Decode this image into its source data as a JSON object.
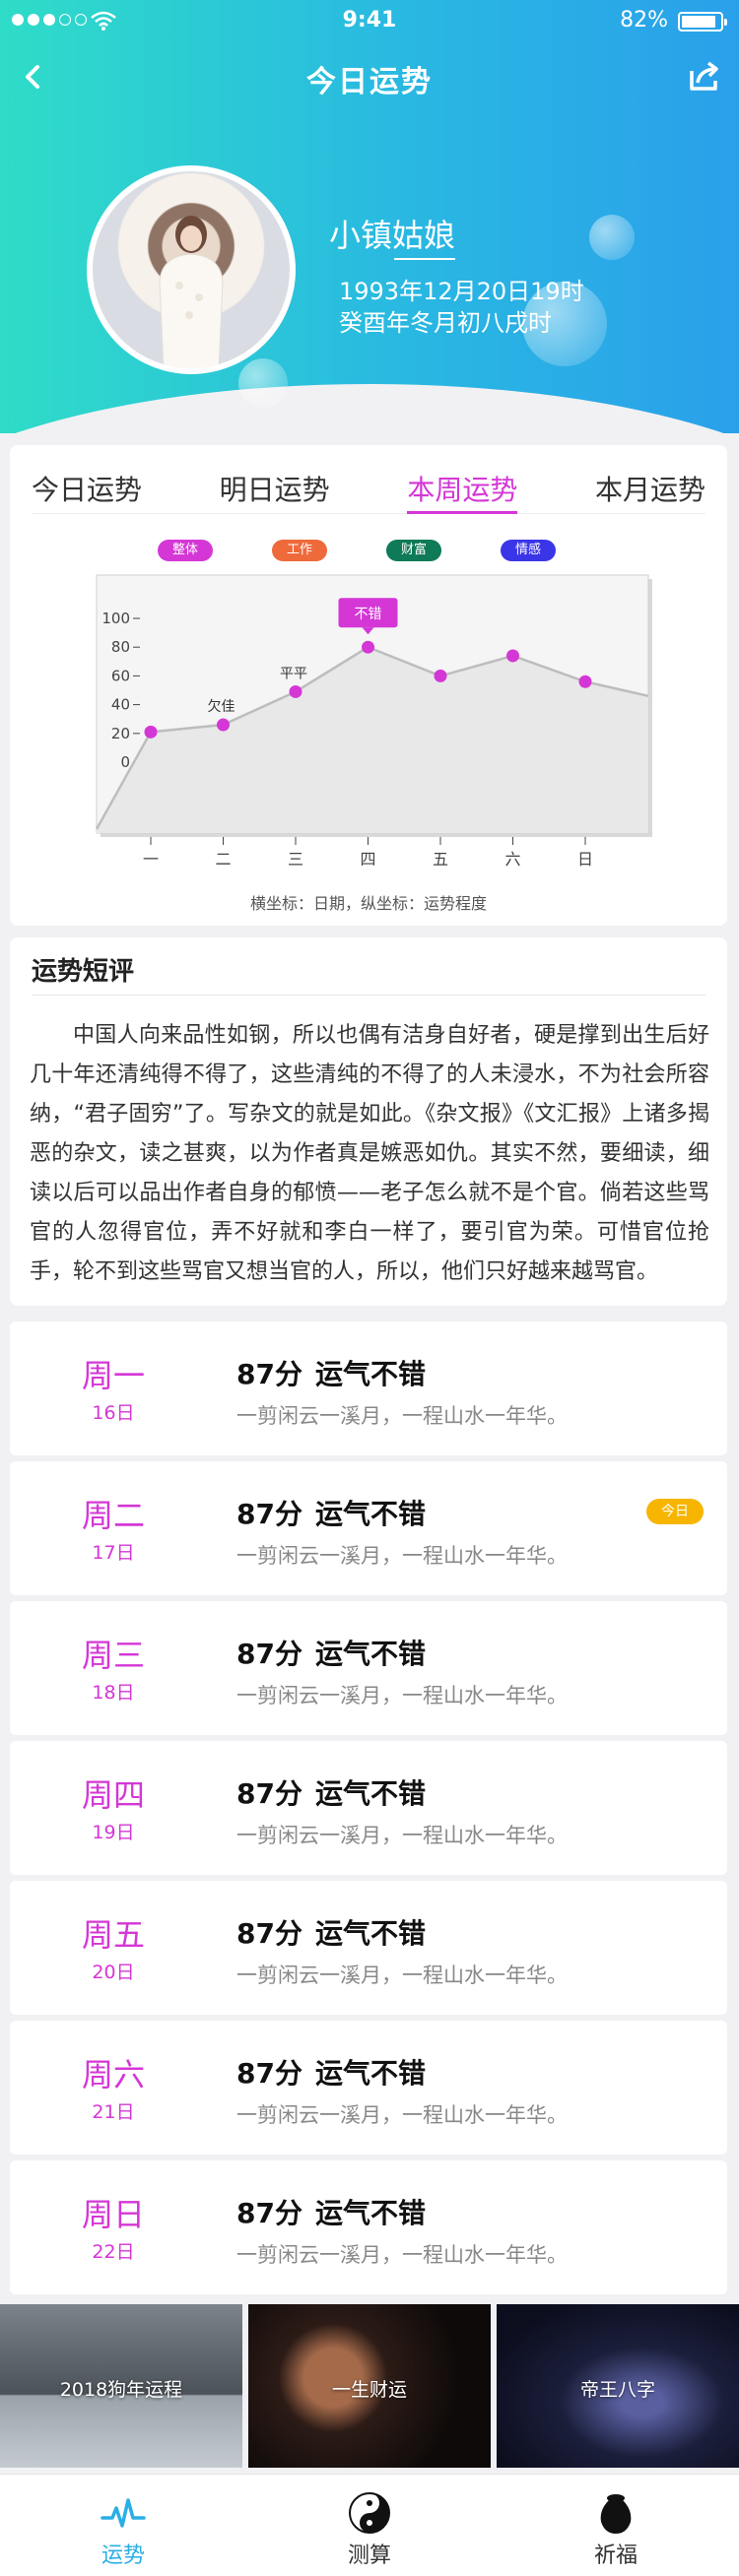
{
  "status_bar": {
    "time": "9:41",
    "battery": "82%"
  },
  "nav": {
    "title": "今日运势"
  },
  "profile": {
    "name": "小镇姑娘",
    "birth_solar": "1993年12月20日19时",
    "birth_lunar": "癸酉年冬月初八戌时"
  },
  "tabs": [
    {
      "label": "今日运势",
      "active": false
    },
    {
      "label": "明日运势",
      "active": false
    },
    {
      "label": "本周运势",
      "active": true
    },
    {
      "label": "本月运势",
      "active": false
    }
  ],
  "legend": [
    {
      "label": "整体",
      "color": "#d437d6"
    },
    {
      "label": "工作",
      "color": "#ee6a3b"
    },
    {
      "label": "财富",
      "color": "#0f7a57"
    },
    {
      "label": "情感",
      "color": "#3b35e8"
    }
  ],
  "chart_data": {
    "type": "line",
    "categories": [
      "一",
      "二",
      "三",
      "四",
      "五",
      "六",
      "日"
    ],
    "values": [
      21,
      26,
      49,
      80,
      60,
      74,
      56
    ],
    "ylim": [
      0,
      100
    ],
    "yticks": [
      "100",
      "80",
      "60",
      "40",
      "20",
      "0"
    ],
    "point_labels": {
      "1": "欠佳",
      "2": "平平",
      "3": "不错"
    },
    "caption": "横坐标：日期，纵坐标：运势程度",
    "line_color": "#bdbdbd",
    "point_color": "#d437d6"
  },
  "commentary": {
    "title": "运势短评",
    "body": "中国人向来品性如钢，所以也偶有洁身自好者，硬是撑到出生后好几十年还清纯得不得了，这些清纯的不得了的人未浸水，不为社会所容纳，“君子固穷”了。写杂文的就是如此。《杂文报》《文汇报》上诸多揭恶的杂文，读之甚爽，以为作者真是嫉恶如仇。其实不然，要细读，细读以后可以品出作者自身的郁愤——老子怎么就不是个官。倘若这些骂官的人忽得官位，弄不好就和李白一样了，要引官为荣。可惜官位抢手，轮不到这些骂官又想当官的人，所以，他们只好越来越骂官。"
  },
  "days": [
    {
      "weekday": "周一",
      "date": "16日",
      "score": "87分",
      "verdict": "运气不错",
      "poem": "一剪闲云一溪月，一程山水一年华。"
    },
    {
      "weekday": "周二",
      "date": "17日",
      "score": "87分",
      "verdict": "运气不错",
      "poem": "一剪闲云一溪月，一程山水一年华。",
      "badge": "今日"
    },
    {
      "weekday": "周三",
      "date": "18日",
      "score": "87分",
      "verdict": "运气不错",
      "poem": "一剪闲云一溪月，一程山水一年华。"
    },
    {
      "weekday": "周四",
      "date": "19日",
      "score": "87分",
      "verdict": "运气不错",
      "poem": "一剪闲云一溪月，一程山水一年华。"
    },
    {
      "weekday": "周五",
      "date": "20日",
      "score": "87分",
      "verdict": "运气不错",
      "poem": "一剪闲云一溪月，一程山水一年华。"
    },
    {
      "weekday": "周六",
      "date": "21日",
      "score": "87分",
      "verdict": "运气不错",
      "poem": "一剪闲云一溪月，一程山水一年华。"
    },
    {
      "weekday": "周日",
      "date": "22日",
      "score": "87分",
      "verdict": "运气不错",
      "poem": "一剪闲云一溪月，一程山水一年华。"
    }
  ],
  "banners": [
    {
      "label": "2018狗年运程"
    },
    {
      "label": "一生财运"
    },
    {
      "label": "帝王八字"
    }
  ],
  "bottom_nav": [
    {
      "label": "运势",
      "icon": "pulse-icon",
      "active": true
    },
    {
      "label": "测算",
      "icon": "yin-yang-icon",
      "active": false
    },
    {
      "label": "祈福",
      "icon": "blessing-pot-icon",
      "active": false
    }
  ]
}
